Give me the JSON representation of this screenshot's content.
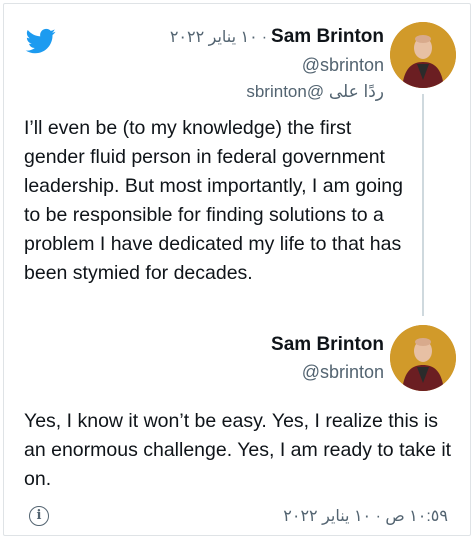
{
  "brand_color": "#1d9bf0",
  "header_icon": "twitter-bird-icon",
  "tweet1": {
    "name": "Sam Brinton",
    "date": "١٠ يناير ٢٠٢٢",
    "separator": "·",
    "handle": "@sbrinton",
    "reply_prefix": "ردًا على",
    "reply_mention": "@sbrinton",
    "text": "I’ll even be (to my knowledge) the first gender fluid person in federal government leadership. But most importantly, I am going to be responsible for finding solutions to a problem I have dedicated my life to that has been stymied for decades."
  },
  "tweet2": {
    "name": "Sam Brinton",
    "handle": "@sbrinton",
    "text": "Yes, I know it won’t be easy. Yes, I realize this is an enormous challenge. Yes, I am ready to take it on.",
    "footer_time": "١٠:٥٩ ص",
    "footer_separator": "·",
    "footer_date": "١٠ يناير ٢٠٢٢",
    "info_icon": "info-icon",
    "info_glyph": "i"
  }
}
